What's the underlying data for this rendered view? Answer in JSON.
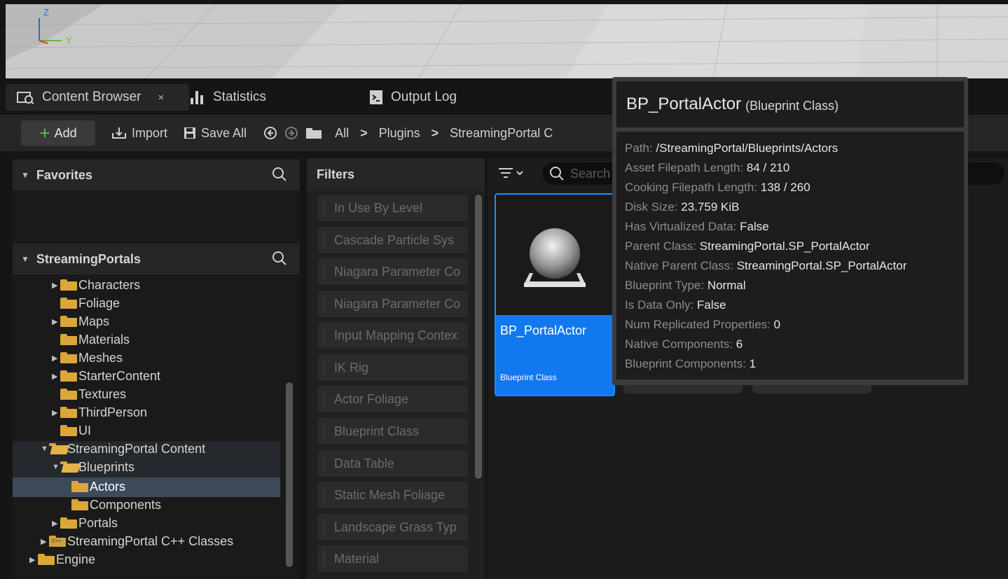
{
  "viewport": {
    "axis_z": "Z",
    "axis_y": "Y"
  },
  "tabs": [
    {
      "label": "Content Browser",
      "close": "×"
    },
    {
      "label": "Statistics"
    },
    {
      "label": "Output Log"
    }
  ],
  "toolbar": {
    "add_label": "Add",
    "import_label": "Import",
    "save_all_label": "Save All",
    "breadcrumb": [
      "All",
      "Plugins",
      "StreamingPortal C"
    ]
  },
  "left_panel": {
    "favorites_label": "Favorites",
    "project_label": "StreamingPortals",
    "tree": [
      {
        "label": "Characters",
        "expandable": true
      },
      {
        "label": "Foliage",
        "expandable": false
      },
      {
        "label": "Maps",
        "expandable": true
      },
      {
        "label": "Materials",
        "expandable": false
      },
      {
        "label": "Meshes",
        "expandable": true
      },
      {
        "label": "StarterContent",
        "expandable": true
      },
      {
        "label": "Textures",
        "expandable": false
      },
      {
        "label": "ThirdPerson",
        "expandable": true
      },
      {
        "label": "UI",
        "expandable": false
      },
      {
        "label": "StreamingPortal Content",
        "expandable": true
      },
      {
        "label": "Blueprints",
        "expandable": true
      },
      {
        "label": "Actors",
        "expandable": false
      },
      {
        "label": "Components",
        "expandable": false
      },
      {
        "label": "Portals",
        "expandable": true
      },
      {
        "label": "StreamingPortal C++ Classes",
        "expandable": true
      },
      {
        "label": "Engine",
        "expandable": true
      }
    ]
  },
  "filters": {
    "header": "Filters",
    "items": [
      "In Use By Level",
      "Cascade Particle Sys",
      "Niagara Parameter Co",
      "Niagara Parameter Co",
      "Input Mapping Contex",
      "IK Rig",
      "Actor Foliage",
      "Blueprint Class",
      "Data Table",
      "Static Mesh Foliage",
      "Landscape Grass Typ",
      "Material"
    ]
  },
  "content": {
    "search_placeholder": "Search",
    "asset": {
      "name": "BP_PortalActor",
      "type": "Blueprint Class"
    }
  },
  "tooltip": {
    "title": "BP_PortalActor",
    "subtitle": "(Blueprint Class)",
    "rows": [
      {
        "key": "Path: ",
        "value": "/StreamingPortal/Blueprints/Actors"
      },
      {
        "key": "Asset Filepath Length: ",
        "value": "84 / 210"
      },
      {
        "key": "Cooking Filepath Length: ",
        "value": "138 / 260"
      },
      {
        "key": "Disk Size: ",
        "value": "23.759 KiB"
      },
      {
        "key": "Has Virtualized Data: ",
        "value": "False"
      },
      {
        "key": "Parent Class: ",
        "value": "StreamingPortal.SP_PortalActor"
      },
      {
        "key": "Native Parent Class: ",
        "value": "StreamingPortal.SP_PortalActor"
      },
      {
        "key": "Blueprint Type: ",
        "value": "Normal"
      },
      {
        "key": "Is Data Only: ",
        "value": "False"
      },
      {
        "key": "Num Replicated Properties: ",
        "value": "0"
      },
      {
        "key": "Native Components: ",
        "value": "6"
      },
      {
        "key": "Blueprint Components: ",
        "value": "1"
      }
    ]
  },
  "colors": {
    "accent": "#1278f0",
    "folder": "#dba63a",
    "add_plus": "#56c04a",
    "selection": "#3c4a5a"
  }
}
